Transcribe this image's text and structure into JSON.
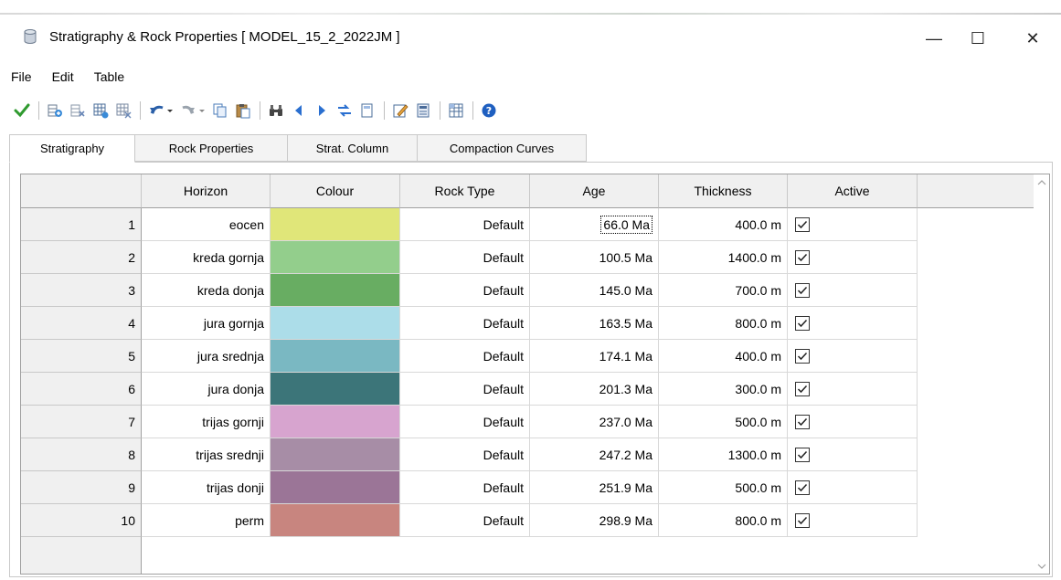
{
  "window": {
    "title": "Stratigraphy & Rock Properties [ MODEL_15_2_2022JM ]",
    "minimize": "—",
    "maximize": "☐",
    "close": "✕"
  },
  "menu": [
    "File",
    "Edit",
    "Table"
  ],
  "tabs": [
    "Stratigraphy",
    "Rock Properties",
    "Strat. Column",
    "Compaction Curves"
  ],
  "active_tab": "Stratigraphy",
  "table": {
    "columns": [
      "",
      "Horizon",
      "Colour",
      "Rock Type",
      "Age",
      "Thickness",
      "Active"
    ],
    "rows": [
      {
        "num": "1",
        "horizon": "eocen",
        "color": "#e0e679",
        "rock_type": "Default",
        "age": "66.0 Ma",
        "thickness": "400.0 m",
        "active": true
      },
      {
        "num": "2",
        "horizon": "kreda gornja",
        "color": "#93ce8c",
        "rock_type": "Default",
        "age": "100.5 Ma",
        "thickness": "1400.0 m",
        "active": true
      },
      {
        "num": "3",
        "horizon": "kreda donja",
        "color": "#68ad62",
        "rock_type": "Default",
        "age": "145.0 Ma",
        "thickness": "700.0 m",
        "active": true
      },
      {
        "num": "4",
        "horizon": "jura gornja",
        "color": "#acdde9",
        "rock_type": "Default",
        "age": "163.5 Ma",
        "thickness": "800.0 m",
        "active": true
      },
      {
        "num": "5",
        "horizon": "jura srednja",
        "color": "#7ab8c2",
        "rock_type": "Default",
        "age": "174.1 Ma",
        "thickness": "400.0 m",
        "active": true
      },
      {
        "num": "6",
        "horizon": "jura donja",
        "color": "#3c7579",
        "rock_type": "Default",
        "age": "201.3 Ma",
        "thickness": "300.0 m",
        "active": true
      },
      {
        "num": "7",
        "horizon": "trijas gornji",
        "color": "#d7a4cf",
        "rock_type": "Default",
        "age": "237.0 Ma",
        "thickness": "500.0 m",
        "active": true
      },
      {
        "num": "8",
        "horizon": "trijas srednji",
        "color": "#a78da6",
        "rock_type": "Default",
        "age": "247.2 Ma",
        "thickness": "1300.0 m",
        "active": true
      },
      {
        "num": "9",
        "horizon": "trijas donji",
        "color": "#9b7597",
        "rock_type": "Default",
        "age": "251.9 Ma",
        "thickness": "500.0 m",
        "active": true
      },
      {
        "num": "10",
        "horizon": "perm",
        "color": "#c8857f",
        "rock_type": "Default",
        "age": "298.9 Ma",
        "thickness": "800.0 m",
        "active": true
      }
    ]
  },
  "toolbar_icons": [
    "check-icon",
    "insert-row-icon",
    "delete-row-icon",
    "insert-block-icon",
    "delete-block-icon",
    "undo-icon",
    "redo-icon",
    "copy-icon",
    "paste-icon",
    "find-icon",
    "prev-icon",
    "next-icon",
    "replace-icon",
    "page-icon",
    "edit-icon",
    "calculator-icon",
    "grid-icon",
    "help-icon"
  ]
}
